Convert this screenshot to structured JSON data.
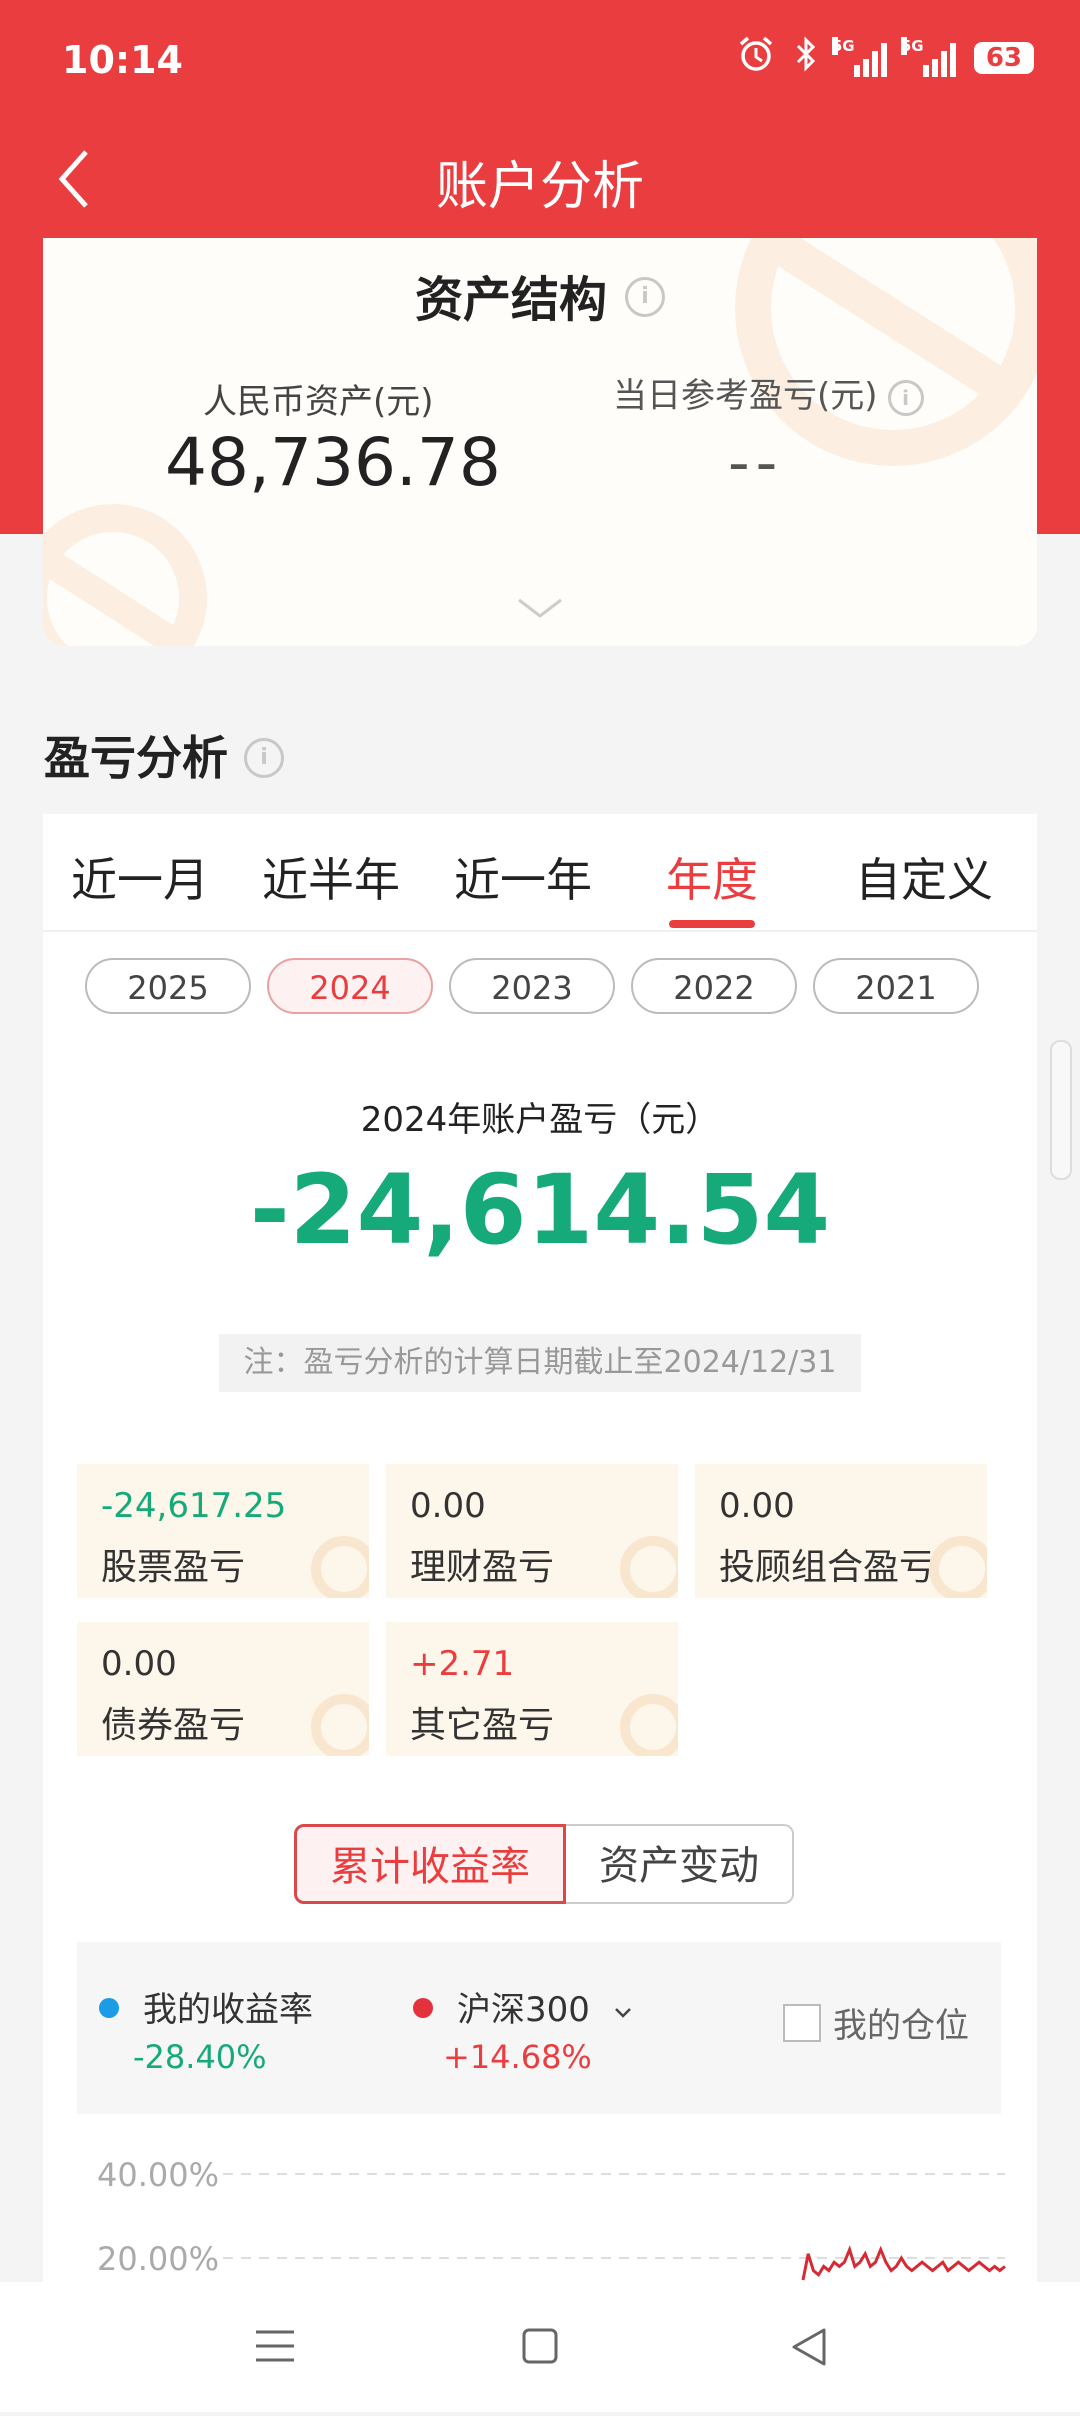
{
  "status_bar": {
    "time": "10:14",
    "battery": "63",
    "net1": "5G",
    "net2": "5G"
  },
  "header": {
    "title": "账户分析"
  },
  "asset": {
    "title": "资产结构",
    "rmb_label": "人民币资产(元)",
    "rmb_value": "48,736.78",
    "daily_label": "当日参考盈亏(元)",
    "daily_value": "--"
  },
  "pl_section": {
    "title": "盈亏分析",
    "tabs": [
      "近一月",
      "近半年",
      "近一年",
      "年度",
      "自定义"
    ],
    "active_tab": "年度",
    "years": [
      "2025",
      "2024",
      "2023",
      "2022",
      "2021"
    ],
    "active_year": "2024",
    "total_label": "2024年账户盈亏（元）",
    "total_value": "-24,614.54",
    "note": "注：盈亏分析的计算日期截止至2024/12/31",
    "items": [
      {
        "value": "-24,617.25",
        "label": "股票盈亏"
      },
      {
        "value": "0.00",
        "label": "理财盈亏"
      },
      {
        "value": "0.00",
        "label": "投顾组合盈亏"
      },
      {
        "value": "0.00",
        "label": "债券盈亏"
      },
      {
        "value": "+2.71",
        "label": "其它盈亏"
      }
    ],
    "segments": [
      "累计收益率",
      "资产变动"
    ]
  },
  "legend": {
    "mine_label": "我的收益率",
    "mine_value": "-28.40%",
    "mine_color": "#1c9be6",
    "index_label": "沪深300",
    "index_value": "+14.68%",
    "index_color": "#e2333d",
    "position_label": "我的仓位"
  },
  "chart_data": {
    "type": "line",
    "y_ticks": [
      "40.00%",
      "20.00%"
    ],
    "series": [
      {
        "name": "沪深300",
        "values": [
          14,
          21,
          17,
          16,
          18,
          17,
          19,
          18,
          19,
          22,
          18,
          19,
          21,
          18,
          19,
          22,
          19,
          17,
          18,
          20,
          18,
          17,
          18,
          19,
          18,
          17,
          18,
          19,
          17,
          18,
          19,
          18,
          17,
          18,
          19,
          18,
          17,
          18,
          17,
          18
        ]
      }
    ]
  }
}
